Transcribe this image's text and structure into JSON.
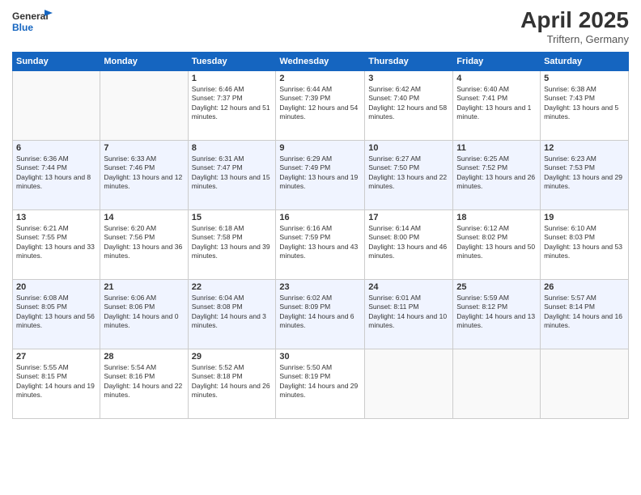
{
  "header": {
    "logo_line1": "General",
    "logo_line2": "Blue",
    "month": "April 2025",
    "location": "Triftern, Germany"
  },
  "weekdays": [
    "Sunday",
    "Monday",
    "Tuesday",
    "Wednesday",
    "Thursday",
    "Friday",
    "Saturday"
  ],
  "weeks": [
    [
      {
        "day": "",
        "info": ""
      },
      {
        "day": "",
        "info": ""
      },
      {
        "day": "1",
        "info": "Sunrise: 6:46 AM\nSunset: 7:37 PM\nDaylight: 12 hours and 51 minutes."
      },
      {
        "day": "2",
        "info": "Sunrise: 6:44 AM\nSunset: 7:39 PM\nDaylight: 12 hours and 54 minutes."
      },
      {
        "day": "3",
        "info": "Sunrise: 6:42 AM\nSunset: 7:40 PM\nDaylight: 12 hours and 58 minutes."
      },
      {
        "day": "4",
        "info": "Sunrise: 6:40 AM\nSunset: 7:41 PM\nDaylight: 13 hours and 1 minute."
      },
      {
        "day": "5",
        "info": "Sunrise: 6:38 AM\nSunset: 7:43 PM\nDaylight: 13 hours and 5 minutes."
      }
    ],
    [
      {
        "day": "6",
        "info": "Sunrise: 6:36 AM\nSunset: 7:44 PM\nDaylight: 13 hours and 8 minutes."
      },
      {
        "day": "7",
        "info": "Sunrise: 6:33 AM\nSunset: 7:46 PM\nDaylight: 13 hours and 12 minutes."
      },
      {
        "day": "8",
        "info": "Sunrise: 6:31 AM\nSunset: 7:47 PM\nDaylight: 13 hours and 15 minutes."
      },
      {
        "day": "9",
        "info": "Sunrise: 6:29 AM\nSunset: 7:49 PM\nDaylight: 13 hours and 19 minutes."
      },
      {
        "day": "10",
        "info": "Sunrise: 6:27 AM\nSunset: 7:50 PM\nDaylight: 13 hours and 22 minutes."
      },
      {
        "day": "11",
        "info": "Sunrise: 6:25 AM\nSunset: 7:52 PM\nDaylight: 13 hours and 26 minutes."
      },
      {
        "day": "12",
        "info": "Sunrise: 6:23 AM\nSunset: 7:53 PM\nDaylight: 13 hours and 29 minutes."
      }
    ],
    [
      {
        "day": "13",
        "info": "Sunrise: 6:21 AM\nSunset: 7:55 PM\nDaylight: 13 hours and 33 minutes."
      },
      {
        "day": "14",
        "info": "Sunrise: 6:20 AM\nSunset: 7:56 PM\nDaylight: 13 hours and 36 minutes."
      },
      {
        "day": "15",
        "info": "Sunrise: 6:18 AM\nSunset: 7:58 PM\nDaylight: 13 hours and 39 minutes."
      },
      {
        "day": "16",
        "info": "Sunrise: 6:16 AM\nSunset: 7:59 PM\nDaylight: 13 hours and 43 minutes."
      },
      {
        "day": "17",
        "info": "Sunrise: 6:14 AM\nSunset: 8:00 PM\nDaylight: 13 hours and 46 minutes."
      },
      {
        "day": "18",
        "info": "Sunrise: 6:12 AM\nSunset: 8:02 PM\nDaylight: 13 hours and 50 minutes."
      },
      {
        "day": "19",
        "info": "Sunrise: 6:10 AM\nSunset: 8:03 PM\nDaylight: 13 hours and 53 minutes."
      }
    ],
    [
      {
        "day": "20",
        "info": "Sunrise: 6:08 AM\nSunset: 8:05 PM\nDaylight: 13 hours and 56 minutes."
      },
      {
        "day": "21",
        "info": "Sunrise: 6:06 AM\nSunset: 8:06 PM\nDaylight: 14 hours and 0 minutes."
      },
      {
        "day": "22",
        "info": "Sunrise: 6:04 AM\nSunset: 8:08 PM\nDaylight: 14 hours and 3 minutes."
      },
      {
        "day": "23",
        "info": "Sunrise: 6:02 AM\nSunset: 8:09 PM\nDaylight: 14 hours and 6 minutes."
      },
      {
        "day": "24",
        "info": "Sunrise: 6:01 AM\nSunset: 8:11 PM\nDaylight: 14 hours and 10 minutes."
      },
      {
        "day": "25",
        "info": "Sunrise: 5:59 AM\nSunset: 8:12 PM\nDaylight: 14 hours and 13 minutes."
      },
      {
        "day": "26",
        "info": "Sunrise: 5:57 AM\nSunset: 8:14 PM\nDaylight: 14 hours and 16 minutes."
      }
    ],
    [
      {
        "day": "27",
        "info": "Sunrise: 5:55 AM\nSunset: 8:15 PM\nDaylight: 14 hours and 19 minutes."
      },
      {
        "day": "28",
        "info": "Sunrise: 5:54 AM\nSunset: 8:16 PM\nDaylight: 14 hours and 22 minutes."
      },
      {
        "day": "29",
        "info": "Sunrise: 5:52 AM\nSunset: 8:18 PM\nDaylight: 14 hours and 26 minutes."
      },
      {
        "day": "30",
        "info": "Sunrise: 5:50 AM\nSunset: 8:19 PM\nDaylight: 14 hours and 29 minutes."
      },
      {
        "day": "",
        "info": ""
      },
      {
        "day": "",
        "info": ""
      },
      {
        "day": "",
        "info": ""
      }
    ]
  ]
}
